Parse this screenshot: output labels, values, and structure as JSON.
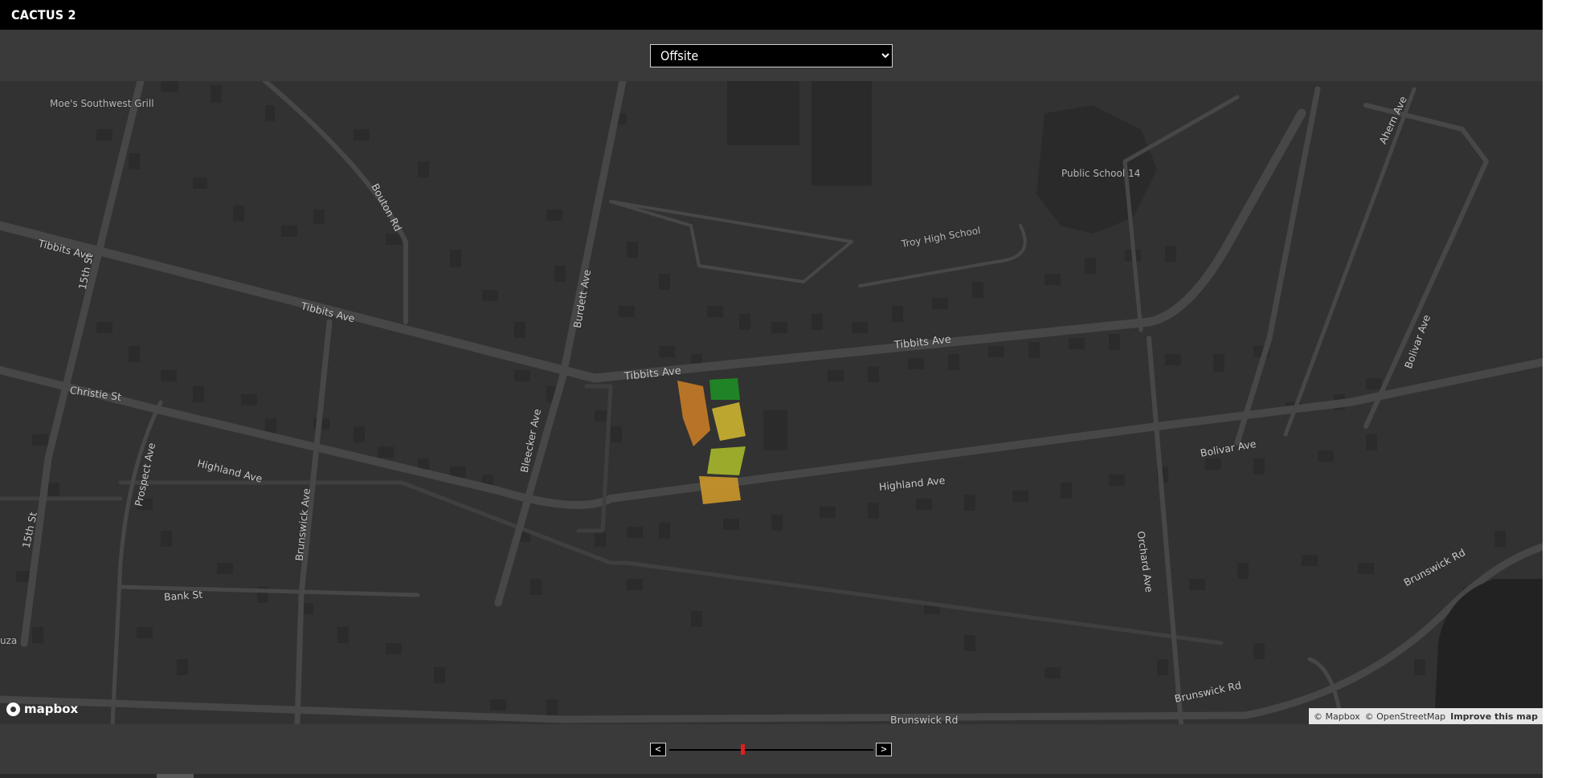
{
  "app": {
    "title": "CACTUS 2"
  },
  "site_select": {
    "selected": "Offsite",
    "options": [
      "Offsite"
    ]
  },
  "map": {
    "labels": {
      "moes": "Moe's Southwest Grill",
      "public_school": "Public School 14",
      "troy_high": "Troy High School",
      "tibbits_1": "Tibbits Ave",
      "tibbits_2": "Tibbits Ave",
      "tibbits_3": "Tibbits Ave",
      "tibbits_4": "Tibbits Ave",
      "st15_1": "15th St",
      "st15_2": "15th St",
      "bouton": "Bouton Rd",
      "burdett": "Burdett Ave",
      "bleecker": "Bleecker Ave",
      "christie": "Christie St",
      "prospect": "Prospect Ave",
      "highland_1": "Highland Ave",
      "highland_2": "Highland Ave",
      "brunswick_ave": "Brunswick Ave",
      "bank": "Bank St",
      "bolivar_1": "Bolivar Ave",
      "bolivar_2": "Bolivar Ave",
      "ahern": "Ahern Ave",
      "orchard": "Orchard Ave",
      "brunswick_rd_1": "Brunswick Rd",
      "brunswick_rd_2": "Brunswick Rd",
      "brunswick_rd_3": "Brunswick Rd",
      "edge_uza": "uza"
    },
    "zone_colors": {
      "zone_1": "#c47a26",
      "zone_2": "#1f8a24",
      "zone_3": "#c9b030",
      "zone_4": "#a6b52b",
      "zone_5": "#c9952b"
    }
  },
  "logo": {
    "text": "mapbox"
  },
  "attribution": {
    "mapbox": "© Mapbox",
    "osm": "© OpenStreetMap",
    "improve": "Improve this map"
  },
  "timeline": {
    "prev_label": "<",
    "next_label": ">",
    "position": 0.36,
    "thumb_color": "#e21c1c"
  }
}
